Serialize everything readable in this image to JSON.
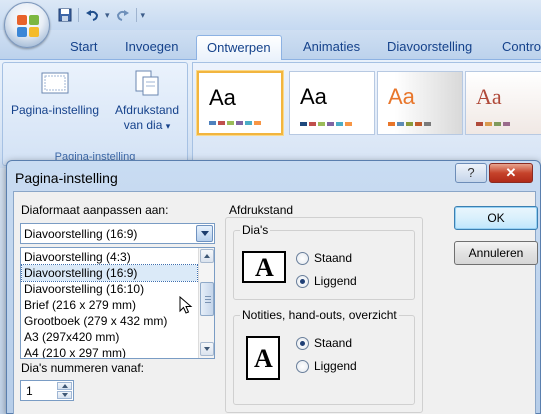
{
  "colors": {
    "dialog_bg": "#f0f0f0",
    "ribbon_text": "#15428b",
    "selection": "#dbeaf8",
    "close_button": "#c6432b",
    "theme_highlight": "#f2b53f"
  },
  "quick_access": {
    "icons": [
      "save-icon",
      "undo-icon",
      "redo-icon",
      "customize-icon"
    ]
  },
  "tabs": [
    "Start",
    "Invoegen",
    "Ontwerpen",
    "Animaties",
    "Diavoorstelling",
    "Contro"
  ],
  "active_tab": "Ontwerpen",
  "ribbon": {
    "pagina_instelling_label": "Pagina-instelling",
    "afdrukstand_label": "Afdrukstand",
    "afdrukstand_sub": "van dia",
    "group_label": "Pagina-instelling",
    "themes": [
      {
        "text": "Aa",
        "style": "office-theme"
      },
      {
        "text": "Aa",
        "style": "plain-theme"
      },
      {
        "text": "Aa",
        "style": "orange-theme"
      },
      {
        "text": "Aa",
        "style": "red-theme"
      }
    ]
  },
  "dialog": {
    "title": "Pagina-instelling",
    "help_glyph": "?",
    "close_glyph": "✕",
    "format_label": "Diaformaat aanpassen aan:",
    "format_selected": "Diavoorstelling (16:9)",
    "format_options": [
      "Diavoorstelling (4:3)",
      "Diavoorstelling (16:9)",
      "Diavoorstelling (16:10)",
      "Brief (216 x 279 mm)",
      "Grootboek (279 x 432 mm)",
      "A3 (297x420 mm)",
      "A4 (210 x 297 mm)"
    ],
    "start_label": "Dia's nummeren vanaf:",
    "start_value": "1",
    "orientation_label": "Afdrukstand",
    "slides_label": "Dia's",
    "slides_portrait": "Staand",
    "slides_landscape": "Liggend",
    "slides_selected": "landscape",
    "notes_label": "Notities, hand-outs, overzicht",
    "notes_portrait": "Staand",
    "notes_landscape": "Liggend",
    "notes_selected": "portrait",
    "icon_letter": "A",
    "ok": "OK",
    "cancel": "Annuleren"
  }
}
